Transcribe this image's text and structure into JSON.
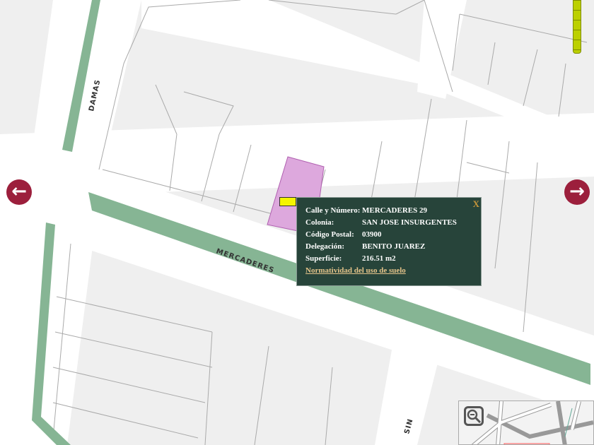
{
  "map": {
    "street_labels": [
      "DAMAS",
      "MERCADERES",
      "SIN"
    ],
    "colors": {
      "background": "#efefef",
      "street": "#ffffff",
      "median": "#86b594",
      "parcel": "#dda8dd",
      "popup": "#27443a",
      "arrow": "#9c1f3c"
    }
  },
  "nav": {
    "left_icon": "arrow-left-icon",
    "right_icon": "arrow-right-icon",
    "left_glyph": "←",
    "right_glyph": "→"
  },
  "popup": {
    "close_label": "X",
    "rows": [
      {
        "key": "Calle y Número:",
        "value": "MERCADERES 29"
      },
      {
        "key": "Colonia:",
        "value": "SAN JOSE INSURGENTES"
      },
      {
        "key": "Código Postal:",
        "value": "03900"
      },
      {
        "key": "Delegación:",
        "value": "BENITO JUAREZ"
      },
      {
        "key": "Superficie:",
        "value": "216.51 m2"
      }
    ],
    "link": "Normatividad del uso de suelo"
  }
}
